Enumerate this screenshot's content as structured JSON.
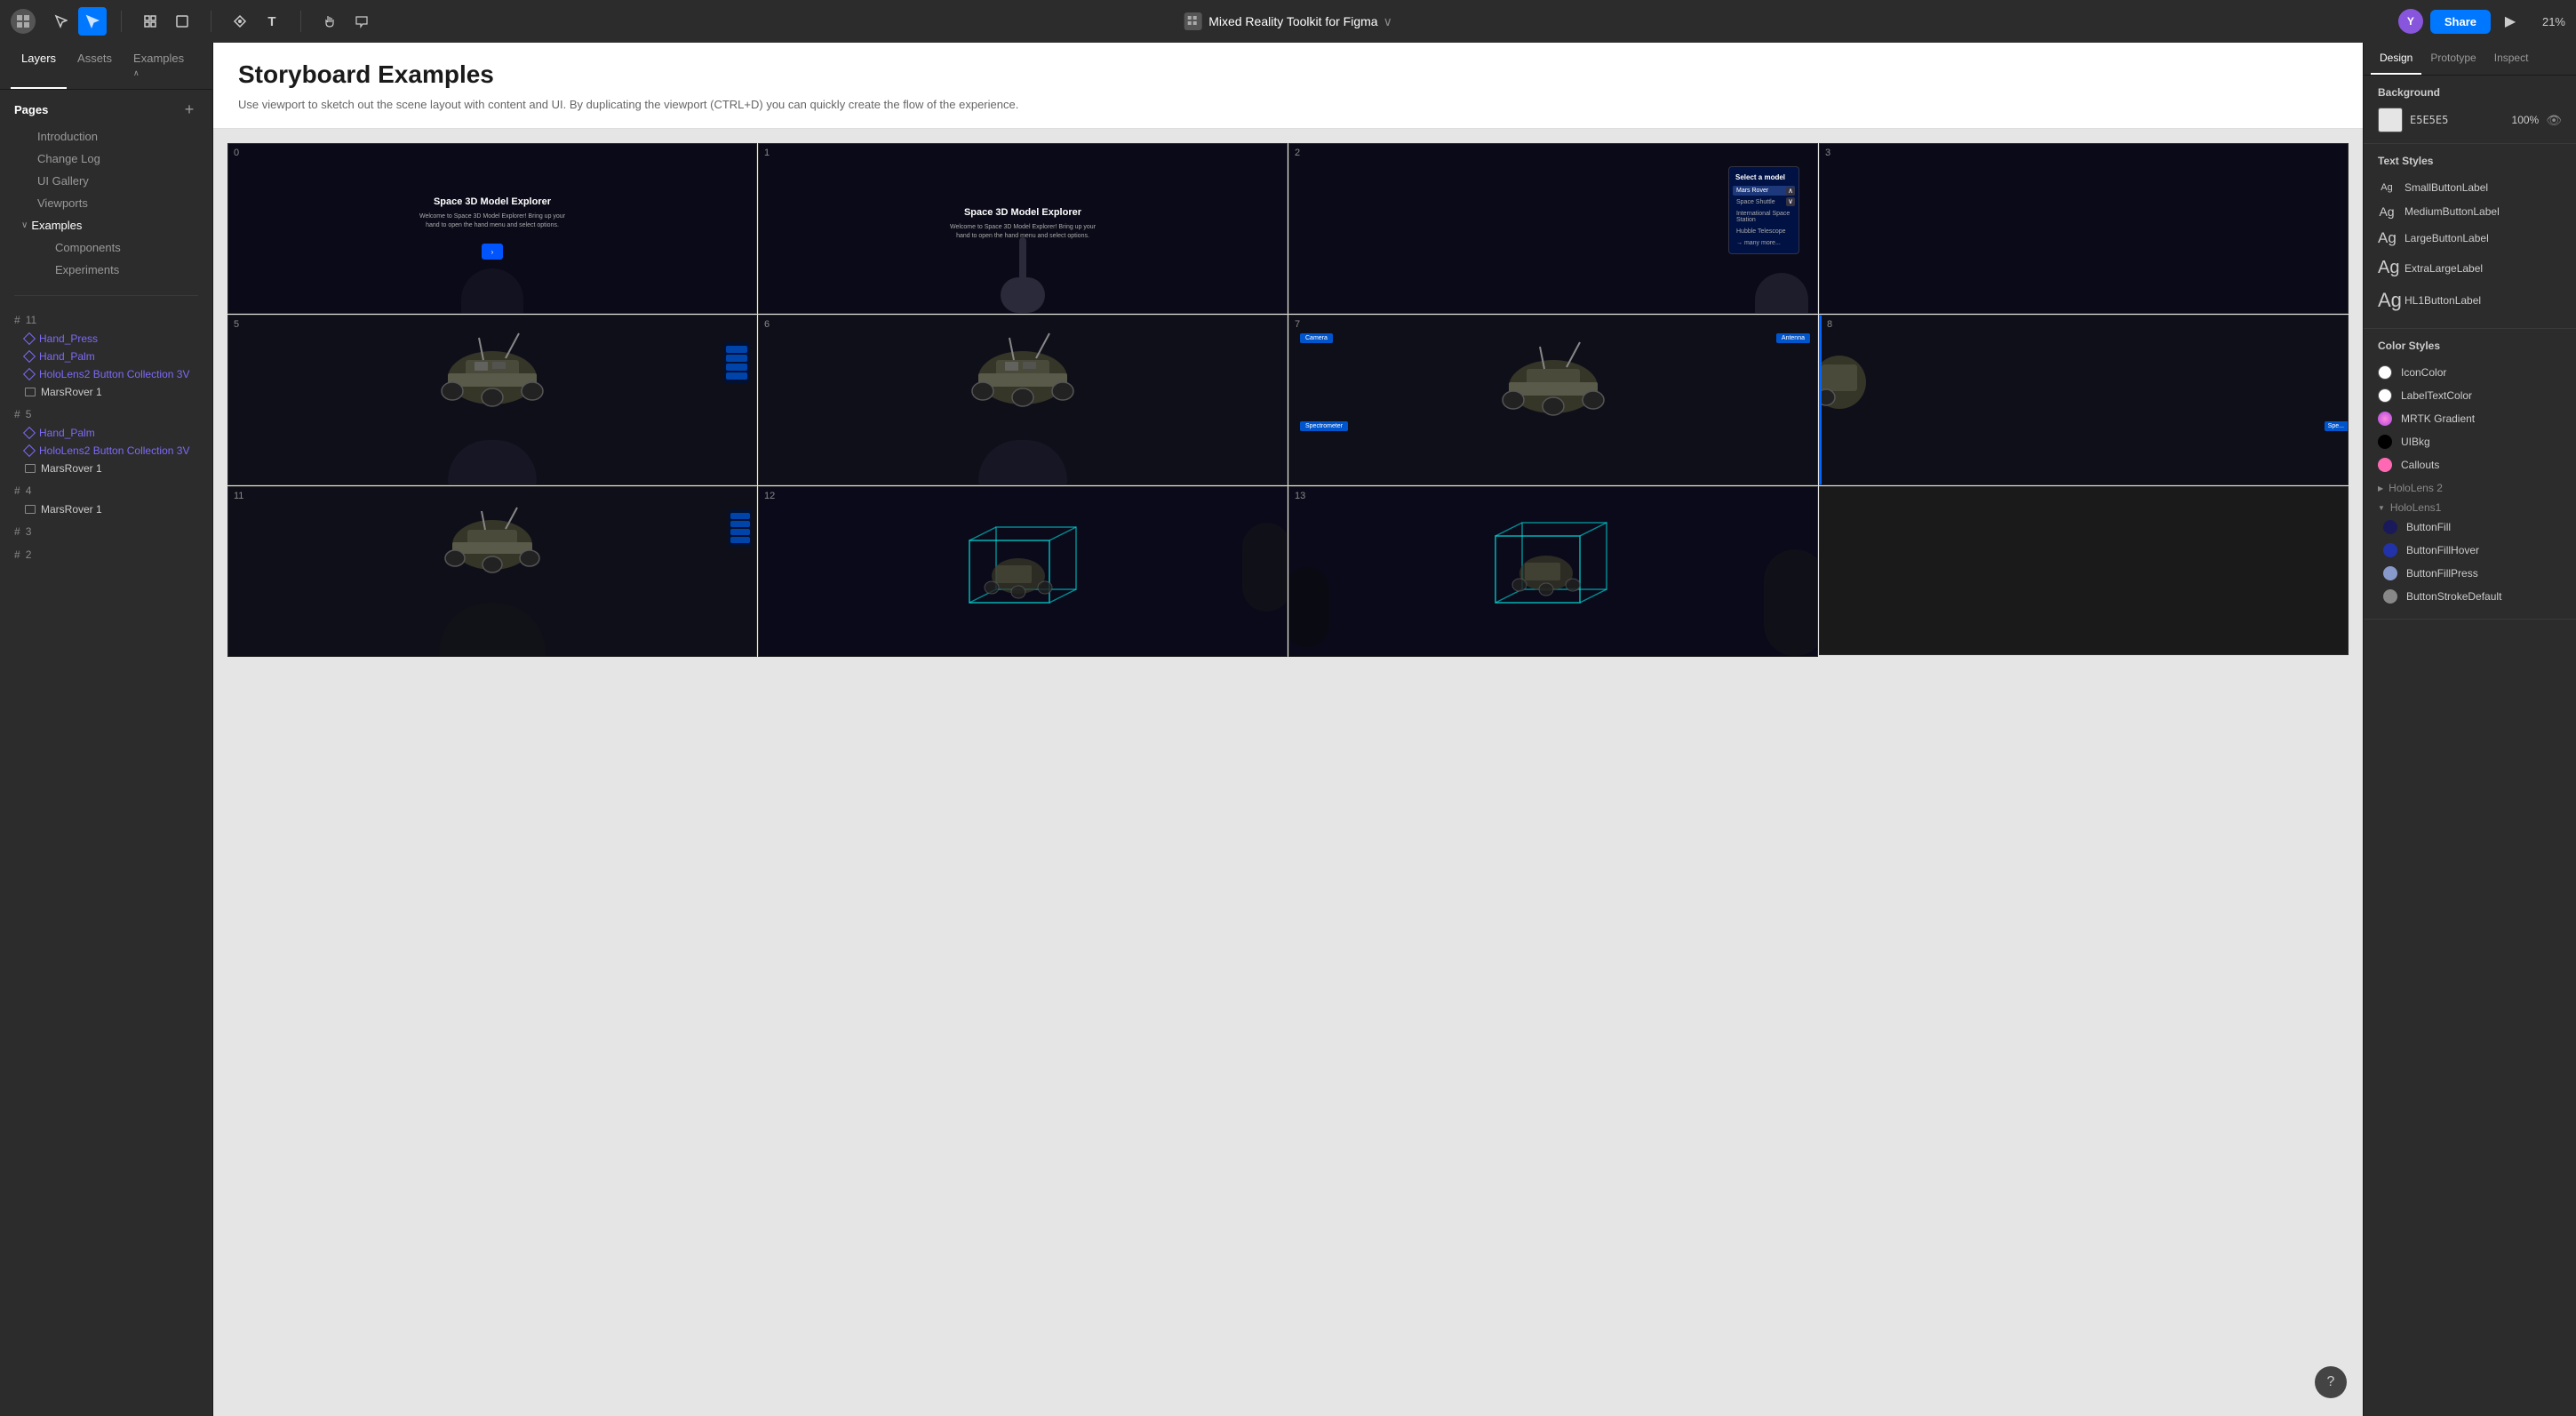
{
  "app": {
    "title": "Mixed Reality Toolkit for Figma",
    "zoom": "21%"
  },
  "toolbar": {
    "logo_label": "⊞",
    "tools": [
      {
        "name": "move",
        "label": "▲",
        "active": false
      },
      {
        "name": "arrow",
        "label": "↖",
        "active": true
      },
      {
        "name": "frame",
        "label": "⬚",
        "active": false
      },
      {
        "name": "shape",
        "label": "□",
        "active": false
      },
      {
        "name": "pen",
        "label": "✒",
        "active": false
      },
      {
        "name": "text",
        "label": "T",
        "active": false
      },
      {
        "name": "hand",
        "label": "✋",
        "active": false
      },
      {
        "name": "comment",
        "label": "💬",
        "active": false
      }
    ],
    "share_label": "Share",
    "avatar_label": "Y",
    "play_label": "▶"
  },
  "left_panel": {
    "tabs": [
      {
        "id": "layers",
        "label": "Layers",
        "active": true
      },
      {
        "id": "assets",
        "label": "Assets",
        "active": false
      },
      {
        "id": "examples",
        "label": "Examples ∨",
        "active": false
      }
    ],
    "pages_title": "Pages",
    "pages": [
      {
        "id": "introduction",
        "label": "Introduction",
        "active": false
      },
      {
        "id": "changelog",
        "label": "Change Log",
        "active": false
      },
      {
        "id": "gallery",
        "label": "UI Gallery",
        "active": false
      },
      {
        "id": "viewports",
        "label": "Viewports",
        "active": false
      },
      {
        "id": "examples",
        "label": "Examples",
        "active": true,
        "collapsible": true,
        "expanded": true
      },
      {
        "id": "components",
        "label": "Components",
        "active": false,
        "indent": true
      },
      {
        "id": "experiments",
        "label": "Experiments",
        "active": false,
        "indent": true
      }
    ],
    "layers": [
      {
        "group_num": "11",
        "items": [
          {
            "type": "diamond",
            "name": "Hand_Press"
          },
          {
            "type": "diamond",
            "name": "Hand_Palm"
          },
          {
            "type": "diamond",
            "name": "HoloLens2 Button Collection 3V"
          },
          {
            "type": "image",
            "name": "MarsRover 1"
          }
        ]
      },
      {
        "group_num": "5",
        "items": [
          {
            "type": "diamond",
            "name": "Hand_Palm"
          },
          {
            "type": "diamond",
            "name": "HoloLens2 Button Collection 3V"
          },
          {
            "type": "image",
            "name": "MarsRover 1"
          }
        ]
      },
      {
        "group_num": "4",
        "items": [
          {
            "type": "image",
            "name": "MarsRover 1"
          }
        ]
      },
      {
        "group_num": "3",
        "items": []
      },
      {
        "group_num": "2",
        "items": []
      }
    ]
  },
  "canvas": {
    "title": "Storyboard Examples",
    "description": "Use viewport to sketch out the scene layout with content and UI. By duplicating the viewport (CTRL+D) you can quickly create the flow of the experience.",
    "cells": [
      {
        "num": "0",
        "type": "intro_scene",
        "title": "Space 3D Model Explorer",
        "subtitle": "Welcome to Space 3D Model Explorer! Bring up your\nhand to open the hand menu and select options."
      },
      {
        "num": "1",
        "type": "finger_scene",
        "title": "Space 3D Model Explorer",
        "subtitle": "Welcome to Space 3D Model Explorer! Bring up your\nhand to open the hand menu and select options."
      },
      {
        "num": "2",
        "type": "menu_scene"
      },
      {
        "num": "3",
        "type": "cut_scene"
      },
      {
        "num": "5",
        "type": "rover_hand",
        "labels": []
      },
      {
        "num": "6",
        "type": "rover_plain",
        "labels": []
      },
      {
        "num": "7",
        "type": "rover_labels",
        "labels": [
          "Camera",
          "Antenna",
          "Spectrometer"
        ]
      },
      {
        "num": "8",
        "type": "rover_partial"
      },
      {
        "num": "11",
        "type": "rover_hand2"
      },
      {
        "num": "12",
        "type": "box_wireframe"
      },
      {
        "num": "13",
        "type": "box_wireframe2"
      }
    ]
  },
  "right_panel": {
    "tabs": [
      {
        "id": "design",
        "label": "Design",
        "active": true
      },
      {
        "id": "prototype",
        "label": "Prototype",
        "active": false
      },
      {
        "id": "inspect",
        "label": "Inspect",
        "active": false
      }
    ],
    "background": {
      "title": "Background",
      "color": "E5E5E5",
      "opacity": "100%"
    },
    "text_styles": {
      "title": "Text Styles",
      "items": [
        {
          "size": "sm",
          "label": "SmallButtonLabel"
        },
        {
          "size": "md",
          "label": "MediumButtonLabel"
        },
        {
          "size": "lg",
          "label": "LargeButtonLabel"
        },
        {
          "size": "xl",
          "label": "ExtraLargeLabel"
        },
        {
          "size": "hl",
          "label": "HL1ButtonLabel"
        }
      ]
    },
    "color_styles": {
      "title": "Color Styles",
      "items": [
        {
          "color": "#ffffff",
          "name": "IconColor",
          "group": null,
          "border": true
        },
        {
          "color": "#ffffff",
          "name": "LabelTextColor",
          "group": null,
          "border": true
        },
        {
          "color": "#ff69b4",
          "name": "MRTK Gradient",
          "group": null,
          "gradient": true
        },
        {
          "color": "#000000",
          "name": "UIBkg",
          "group": null
        },
        {
          "color": "#ff69b4",
          "name": "Callouts",
          "group": null
        }
      ],
      "groups": [
        {
          "name": "HoloLens 2",
          "expanded": false,
          "items": []
        },
        {
          "name": "HoloLens1",
          "expanded": true,
          "items": [
            {
              "color": "#1a1a5a",
              "name": "ButtonFill"
            },
            {
              "color": "#2233aa",
              "name": "ButtonFillHover"
            },
            {
              "color": "#8899cc",
              "name": "ButtonFillPress"
            },
            {
              "color": "#888888",
              "name": "ButtonStrokeDefault"
            }
          ]
        }
      ]
    }
  }
}
